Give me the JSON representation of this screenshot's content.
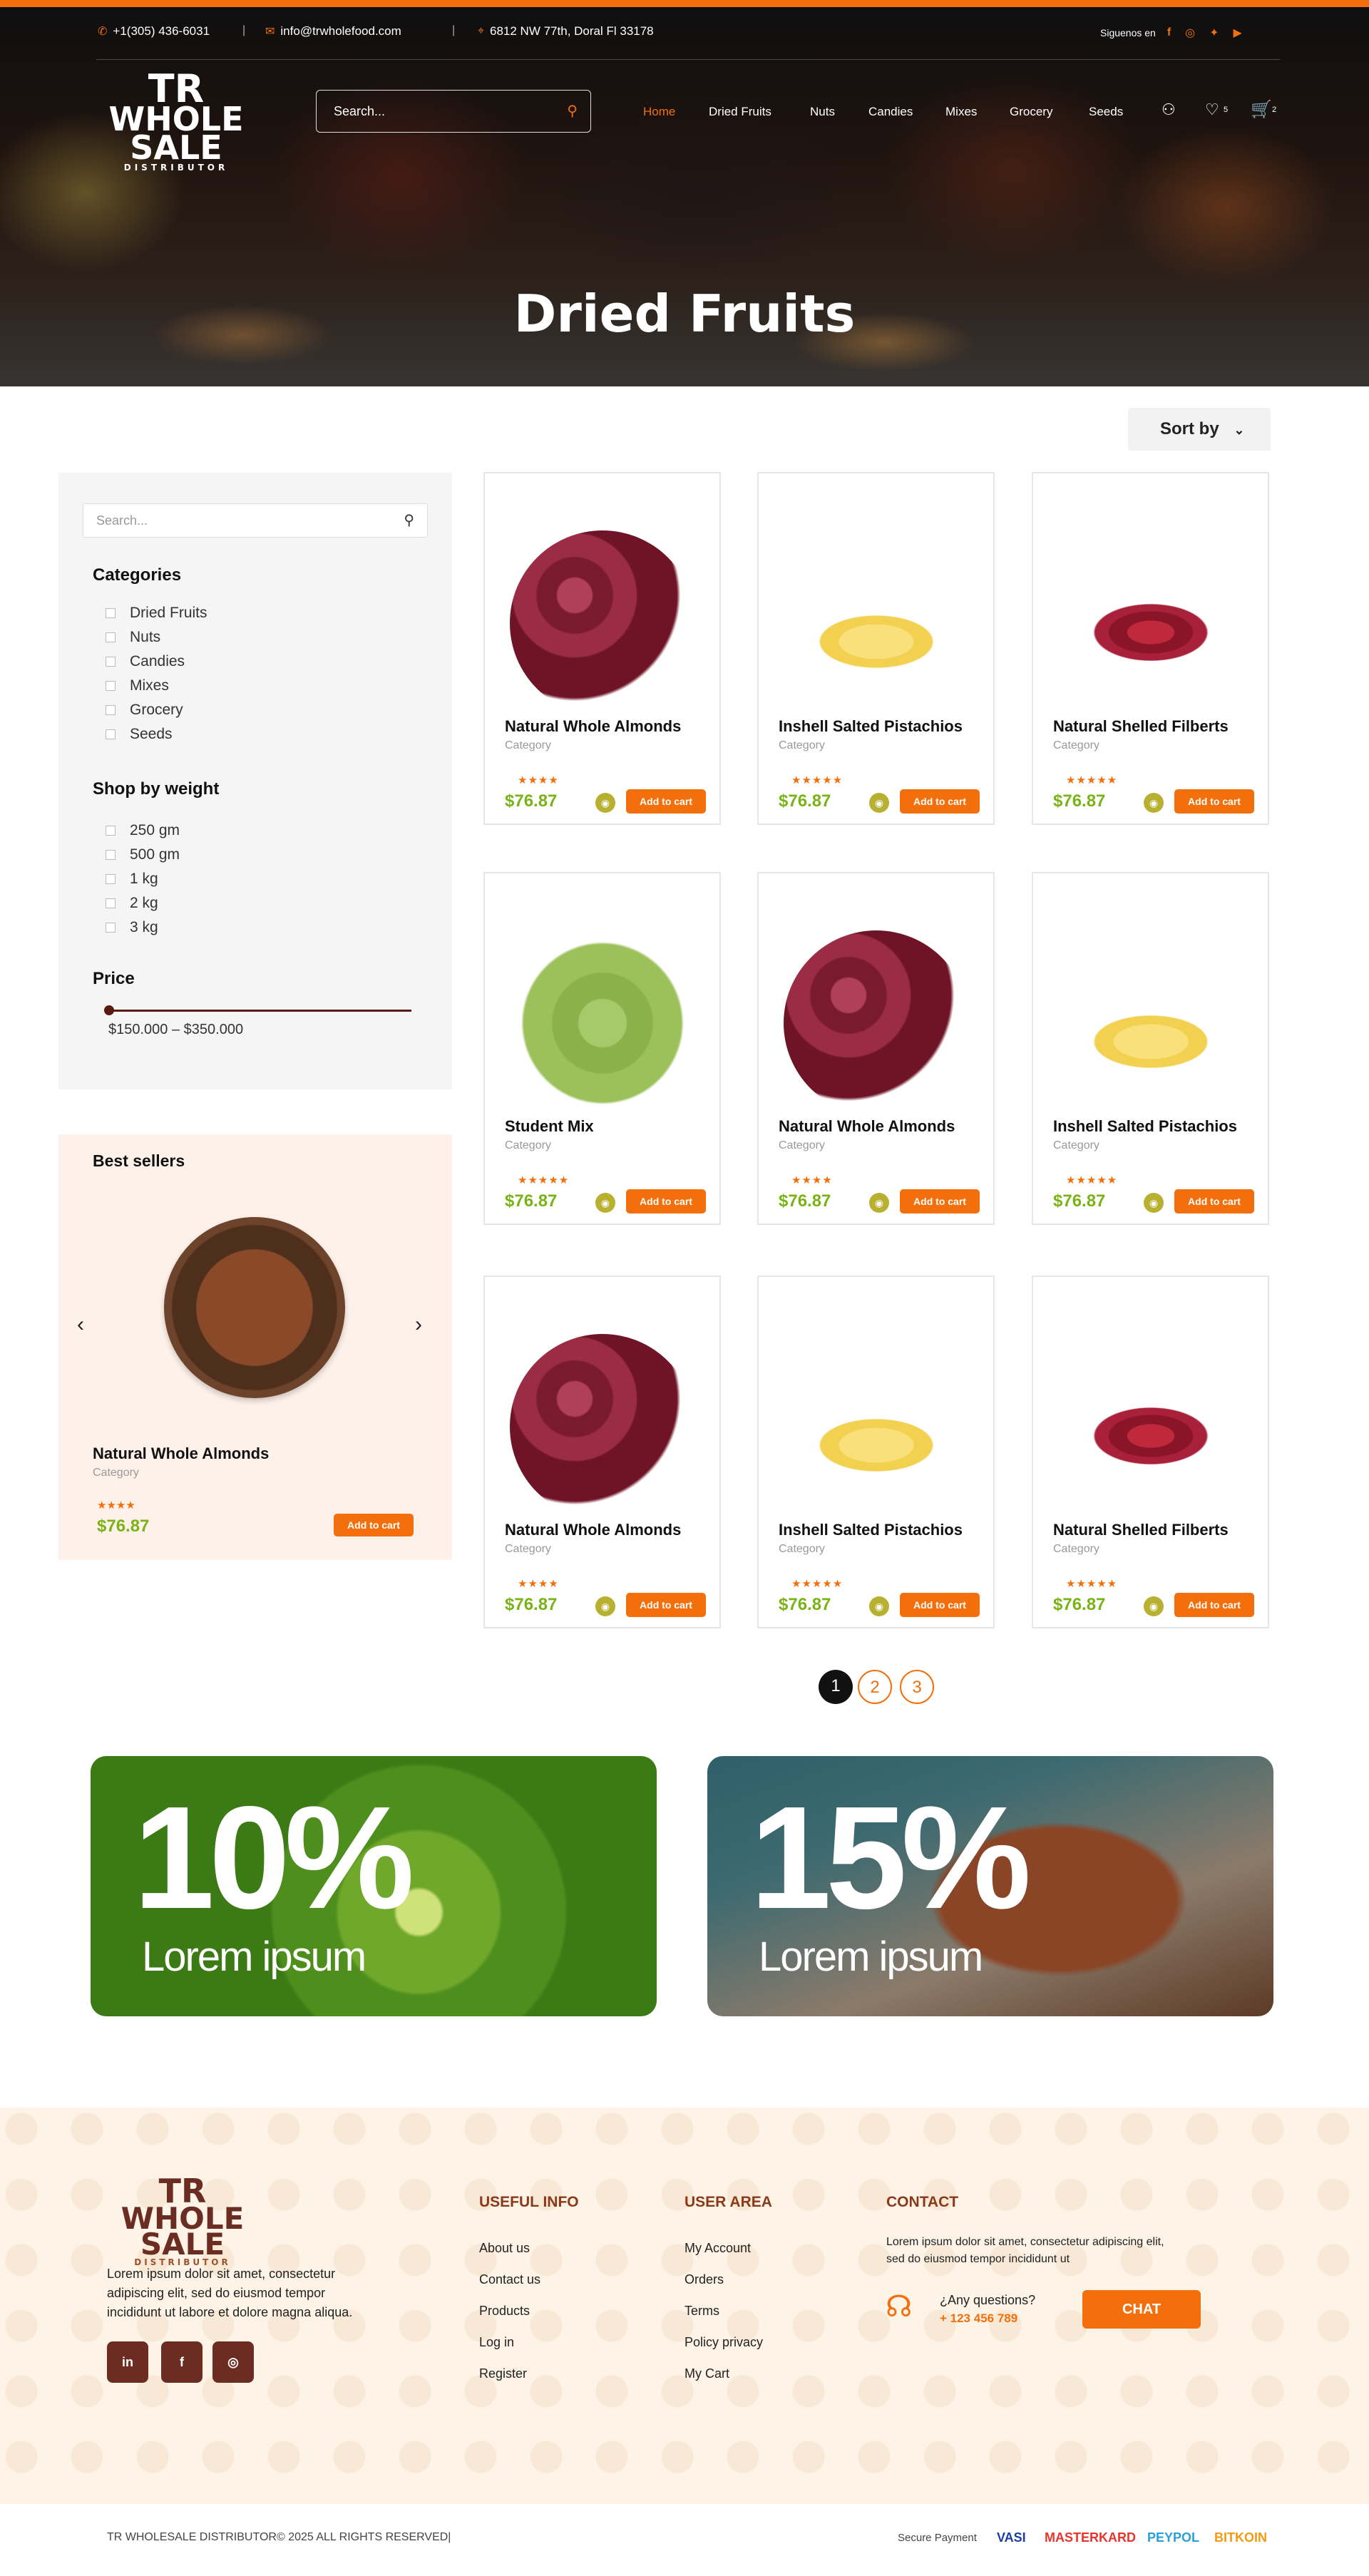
{
  "topbar": {
    "phone": "+1(305) 436-6031",
    "email": "info@trwholefood.com",
    "address": "6812 NW 77th, Doral Fl 33178",
    "follow": "Siguenos en"
  },
  "logo": {
    "line1": "TR",
    "line2": "WHOLE",
    "line3": "SALE",
    "line4": "DISTRIBUTOR"
  },
  "header": {
    "search_placeholder": "Search...",
    "wishlist_count": "5",
    "cart_count": "2"
  },
  "nav": [
    "Home",
    "Dried Fruits",
    "Nuts",
    "Candies",
    "Mixes",
    "Grocery",
    "Seeds"
  ],
  "hero_title": "Dried Fruits",
  "sort_label": "Sort by",
  "filters": {
    "search_placeholder": "Search...",
    "categories_title": "Categories",
    "categories": [
      "Dried Fruits",
      "Nuts",
      "Candies",
      "Mixes",
      "Grocery",
      "Seeds"
    ],
    "weight_title": "Shop by weight",
    "weights": [
      "250 gm",
      "500 gm",
      "1 kg",
      "2 kg",
      "3 kg"
    ],
    "price_title": "Price",
    "price_range": "$150.000 – $350.000"
  },
  "bestsellers": {
    "title": "Best sellers",
    "name": "Natural Whole Almonds",
    "category": "Category",
    "stars": "★★★★",
    "price": "$76.87",
    "button": "Add to cart"
  },
  "products": [
    {
      "name": "Natural Whole Almonds",
      "category": "Category",
      "stars": "★★★★",
      "price": "$76.87",
      "button": "Add to cart",
      "img": "red"
    },
    {
      "name": "Inshell Salted Pistachios",
      "category": "Category",
      "stars": "★★★★★",
      "price": "$76.87",
      "button": "Add to cart",
      "img": "yellow"
    },
    {
      "name": "Natural Shelled Filberts",
      "category": "Category",
      "stars": "★★★★★",
      "price": "$76.87",
      "button": "Add to cart",
      "img": "cran"
    },
    {
      "name": "Student Mix",
      "category": "Category",
      "stars": "★★★★★",
      "price": "$76.87",
      "button": "Add to cart",
      "img": "green"
    },
    {
      "name": "Natural Whole Almonds",
      "category": "Category",
      "stars": "★★★★",
      "price": "$76.87",
      "button": "Add to cart",
      "img": "red"
    },
    {
      "name": "Inshell Salted Pistachios",
      "category": "Category",
      "stars": "★★★★★",
      "price": "$76.87",
      "button": "Add to cart",
      "img": "yellow"
    },
    {
      "name": "Natural Whole Almonds",
      "category": "Category",
      "stars": "★★★★",
      "price": "$76.87",
      "button": "Add to cart",
      "img": "red"
    },
    {
      "name": "Inshell Salted Pistachios",
      "category": "Category",
      "stars": "★★★★★",
      "price": "$76.87",
      "button": "Add to cart",
      "img": "yellow"
    },
    {
      "name": "Natural Shelled Filberts",
      "category": "Category",
      "stars": "★★★★★",
      "price": "$76.87",
      "button": "Add to cart",
      "img": "cran"
    }
  ],
  "pagination": [
    "1",
    "2",
    "3"
  ],
  "promos": [
    {
      "percent": "10%",
      "text": "Lorem ipsum"
    },
    {
      "percent": "15%",
      "text": "Lorem ipsum"
    }
  ],
  "footer": {
    "about": "Lorem ipsum dolor sit amet, consectetur adipiscing elit, sed do eiusmod tempor incididunt ut labore et dolore magna aliqua.",
    "useful_title": "USEFUL INFO",
    "useful": [
      "About us",
      "Contact us",
      "Products",
      "Log in",
      "Register"
    ],
    "user_title": "USER AREA",
    "user": [
      "My Account",
      "Orders",
      "Terms",
      "Policy privacy",
      "My Cart"
    ],
    "contact_title": "CONTACT",
    "contact_text": "Lorem ipsum dolor sit amet, consectetur adipiscing elit, sed do eiusmod tempor incididunt ut",
    "questions": "¿Any questions?",
    "phone": "+ 123 456 789",
    "chat": "CHAT",
    "copyright": "TR WHOLESALE DISTRIBUTOR© 2025 ALL RIGHTS RESERVED|",
    "secure": "Secure Payment",
    "payments": [
      "VASI",
      "MASTERKARD",
      "PEYPOL",
      "BITKOIN"
    ]
  },
  "colors": {
    "accent": "#f36f0c",
    "price": "#7ab317",
    "brand_brown": "#6b2d22"
  }
}
